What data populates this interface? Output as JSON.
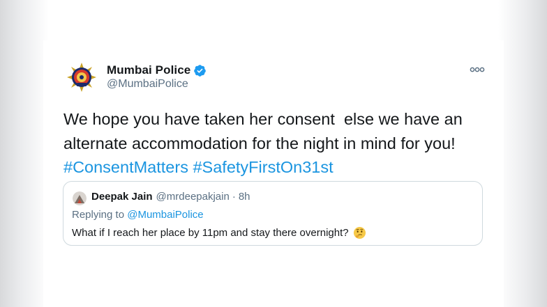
{
  "tweet": {
    "display_name": "Mumbai Police",
    "handle": "@MumbaiPolice",
    "text_line1": "We hope you have taken her consent  else we have an",
    "text_line2": "alternate accommodation for the night in mind for you!",
    "hashtag1": "#ConsentMatters",
    "hashtag2": "#SafetyFirstOn31st",
    "verified_icon": "verified-badge-icon",
    "more_icon": "more-options-icon",
    "avatar_icon": "mumbai-police-emblem-icon"
  },
  "quoted": {
    "display_name": "Deepak Jain",
    "handle": "@mrdeepakjain",
    "separator": "·",
    "time": "8h",
    "replying_prefix": "Replying to ",
    "replying_to": "@MumbaiPolice",
    "text": "What if I reach her place by 11pm and stay there overnight?",
    "emoji_icon": "thinking-face-icon"
  },
  "colors": {
    "link_blue": "#1b95e0",
    "verified_blue": "#1d9bf0",
    "text_dark": "#14171a",
    "text_grey": "#5b7083",
    "border": "#cfd9de"
  }
}
